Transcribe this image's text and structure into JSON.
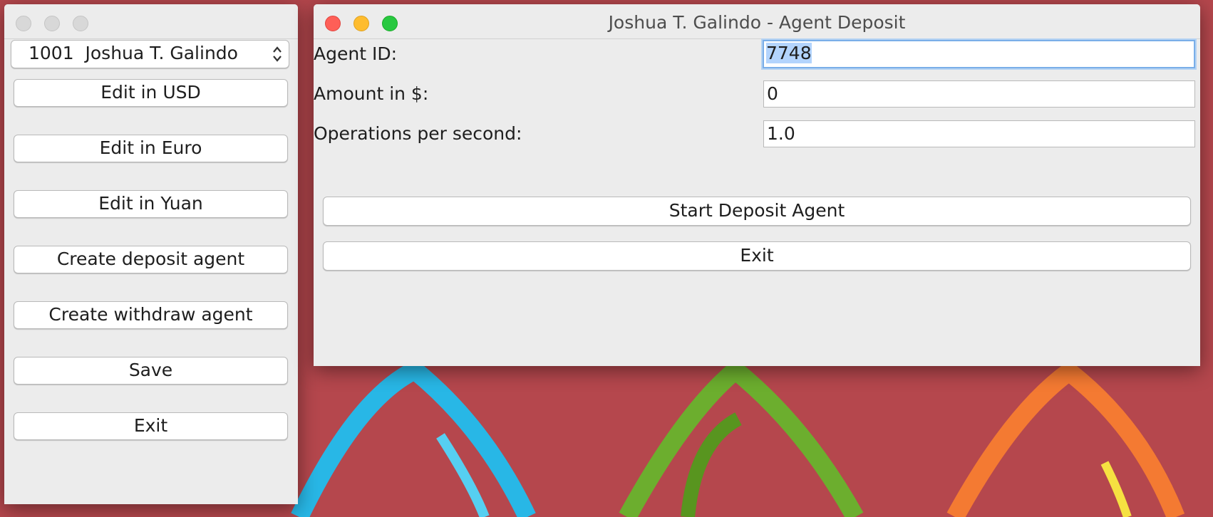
{
  "main_window": {
    "account_select": {
      "value": "1001  Joshua T. Galindo"
    },
    "buttons": [
      "Edit in USD",
      "Edit in Euro",
      "Edit in Yuan",
      "Create deposit agent",
      "Create withdraw agent",
      "Save",
      "Exit"
    ]
  },
  "deposit_window": {
    "title": "Joshua T. Galindo - Agent Deposit",
    "fields": [
      {
        "label": "Agent ID:",
        "value": "7748"
      },
      {
        "label": "Amount in $:",
        "value": "0"
      },
      {
        "label": "Operations per second:",
        "value": "1.0"
      }
    ],
    "start_button": "Start Deposit Agent",
    "exit_button": "Exit"
  },
  "colors": {
    "desktop": "#b5474d",
    "window_bg": "#ececec",
    "close": "#fe5f57",
    "minimize": "#febc2e",
    "zoom": "#28c840",
    "focus_ring": "#7aaee8",
    "selection": "#b3d4fd"
  }
}
